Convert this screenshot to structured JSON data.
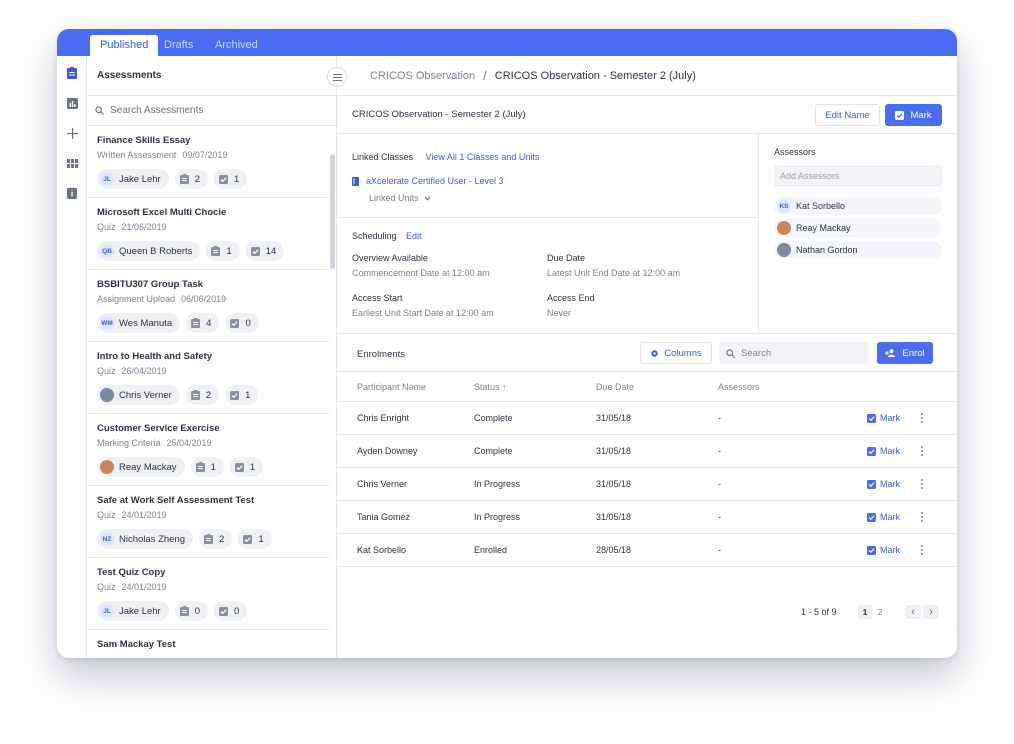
{
  "tabs": [
    {
      "label": "Published",
      "active": true
    },
    {
      "label": "Drafts",
      "active": false
    },
    {
      "label": "Archived",
      "active": false
    }
  ],
  "rail_icons": [
    "assessment-icon",
    "chart-icon",
    "plus-icon",
    "grid-icon",
    "info-icon"
  ],
  "left_panel": {
    "title": "Assessments",
    "search_placeholder": "Search Assessments",
    "items": [
      {
        "title": "Finance Skills Essay",
        "type": "Written Assessment",
        "date": "09/07/2019",
        "initials": "JL",
        "assignee": "Jake Lehr",
        "count_a": "2",
        "count_b": "1"
      },
      {
        "title": "Microsoft Excel Multi Chocie",
        "type": "Quiz",
        "date": "21/06/2019",
        "initials": "QB",
        "assignee": "Queen B Roberts",
        "count_a": "1",
        "count_b": "14"
      },
      {
        "title": "BSBITU307 Group Task",
        "type": "Assignment Upload",
        "date": "06/06/2019",
        "initials": "WM",
        "assignee": "Wes Manuta",
        "count_a": "4",
        "count_b": "0"
      },
      {
        "title": "Intro to Health and Safety",
        "type": "Quiz",
        "date": "26/04/2019",
        "initials": "",
        "assignee": "Chris Verner",
        "count_a": "2",
        "count_b": "1"
      },
      {
        "title": "Customer Service Exercise",
        "type": "Marking Criteria",
        "date": "25/04/2019",
        "initials": "",
        "assignee": "Reay Mackay",
        "count_a": "1",
        "count_b": "1"
      },
      {
        "title": "Safe at Work Self Assessment Test",
        "type": "Quiz",
        "date": "24/01/2019",
        "initials": "NZ",
        "assignee": "Nicholas Zheng",
        "count_a": "2",
        "count_b": "1"
      },
      {
        "title": "Test Quiz Copy",
        "type": "Quiz",
        "date": "24/01/2019",
        "initials": "JL",
        "assignee": "Jake Lehr",
        "count_a": "0",
        "count_b": "0"
      },
      {
        "title": "Sam Mackay Test",
        "type": "",
        "date": "",
        "initials": "",
        "assignee": "",
        "count_a": "",
        "count_b": ""
      }
    ]
  },
  "breadcrumb": {
    "parent": "CRICOS Observation",
    "separator": "/",
    "current": "CRICOS Observation - Semester 2 (July)"
  },
  "header": {
    "title": "CRICOS Observation - Semester 2 (July)",
    "edit_name": "Edit Name",
    "mark": "Mark"
  },
  "linked_classes": {
    "label": "Linked Classes",
    "view_all": "View All 1 Classes and Units",
    "class_name": "aXcelerate Certified User - Level 3",
    "linked_units": "Linked Units"
  },
  "scheduling": {
    "label": "Scheduling",
    "edit": "Edit",
    "overview_label": "Overview Available",
    "overview_value": "Commencement Date at 12:00 am",
    "due_label": "Due Date",
    "due_value": "Latest Unit End Date at 12:00 am",
    "access_start_label": "Access Start",
    "access_start_value": "Earliest Unit Start Date at 12:00 am",
    "access_end_label": "Access End",
    "access_end_value": "Never"
  },
  "assessors": {
    "label": "Assessors",
    "placeholder": "Add Assessors",
    "list": [
      {
        "initials": "KS",
        "name": "Kat Sorbello"
      },
      {
        "initials": "",
        "name": "Reay Mackay"
      },
      {
        "initials": "",
        "name": "Nathan Gordon"
      }
    ]
  },
  "enrolments": {
    "title": "Enrolments",
    "columns_btn": "Columns",
    "search_placeholder": "Search",
    "enrol_btn": "Enrol",
    "headers": [
      "Participant Name",
      "Status",
      "Due Date",
      "Assessors"
    ],
    "sort_arrow": "↑",
    "rows": [
      {
        "name": "Chris Enright",
        "status": "Complete",
        "due": "31/05/18",
        "assessors": "-",
        "action": "Mark"
      },
      {
        "name": "Ayden Downey",
        "status": "Complete",
        "due": "31/05/18",
        "assessors": "-",
        "action": "Mark"
      },
      {
        "name": "Chris Verner",
        "status": "In Progress",
        "due": "31/05/18",
        "assessors": "-",
        "action": "Mark"
      },
      {
        "name": "Tania Gomez",
        "status": "In Progress",
        "due": "31/05/18",
        "assessors": "-",
        "action": "Mark"
      },
      {
        "name": "Kat Sorbello",
        "status": "Enrolled",
        "due": "28/05/18",
        "assessors": "-",
        "action": "Mark"
      }
    ],
    "pagination": {
      "range": "1 - 5 of 9",
      "pages": [
        "1",
        "2"
      ],
      "prev": "‹",
      "next": "›"
    }
  },
  "colors": {
    "accent": "#4a6cf2",
    "text": "#2d3340",
    "muted": "#7b8190"
  }
}
